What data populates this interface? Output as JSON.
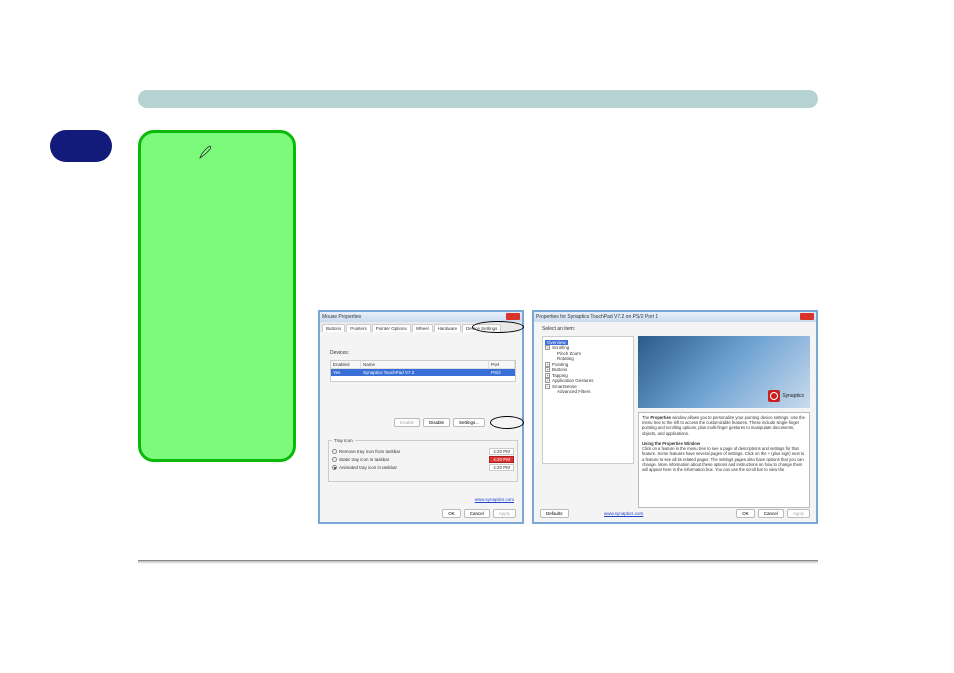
{
  "mouseProps": {
    "title": "Mouse Properties",
    "tabs": [
      "Buttons",
      "Pointers",
      "Pointer Options",
      "Wheel",
      "Hardware",
      "Device Settings"
    ],
    "devicesLabel": "Devices:",
    "columns": {
      "enabled": "Enabled",
      "name": "Name",
      "port": "Port"
    },
    "device": {
      "enabled": "Yes",
      "name": "Synaptics TouchPad V7.2",
      "port": "PS/2"
    },
    "buttons": {
      "enable": "Enable",
      "disable": "Disable",
      "settings": "Settings..."
    },
    "trayIcon": {
      "legend": "Tray Icon",
      "remove": "Remove tray icon from taskbar",
      "static": "Static tray icon in taskbar",
      "animated": "Animated tray icon in taskbar",
      "time": "4:20 PM"
    },
    "link": "www.synaptics.com",
    "dlg": {
      "ok": "OK",
      "cancel": "Cancel",
      "apply": "Apply"
    }
  },
  "synProps": {
    "title": "Properties for Synaptics TouchPad V7.2 on PS/2 Port 1",
    "selectLabel": "Select an item:",
    "tree": {
      "overview": "Overview",
      "scrolling": "Scrolling",
      "pinchZoom": "Pinch Zoom",
      "rotating": "Rotating",
      "pointing": "Pointing",
      "buttons": "Buttons",
      "tapping": "Tapping",
      "appGestures": "Application Gestures",
      "smartSense": "SmartSense",
      "advFilters": "Advanced Filters"
    },
    "logo": "Synaptics",
    "desc": {
      "p1a": "The ",
      "p1b": "Properties",
      "p1c": " window allows you to personalize your pointing device settings. Use the menu tree to the left to access the customizable features. These include single-finger pointing and scrolling options, plus multi-finger gestures to manipulate documents, objects, and applications.",
      "head": "Using the Properties Window",
      "p2": "Click on a feature in the menu tree to see a page of descriptions and settings for that feature. Some features have several pages of settings. Click on the + (plus sign) next to a feature to see all its related pages. The settings pages also have options that you can change. More information about these options and instructions on how to change them will appear here in the information box. You can use the scroll bar to view the"
    },
    "link": "www.synaptics.com",
    "dlg": {
      "defaults": "Defaults",
      "ok": "OK",
      "cancel": "Cancel",
      "apply": "Apply"
    }
  }
}
